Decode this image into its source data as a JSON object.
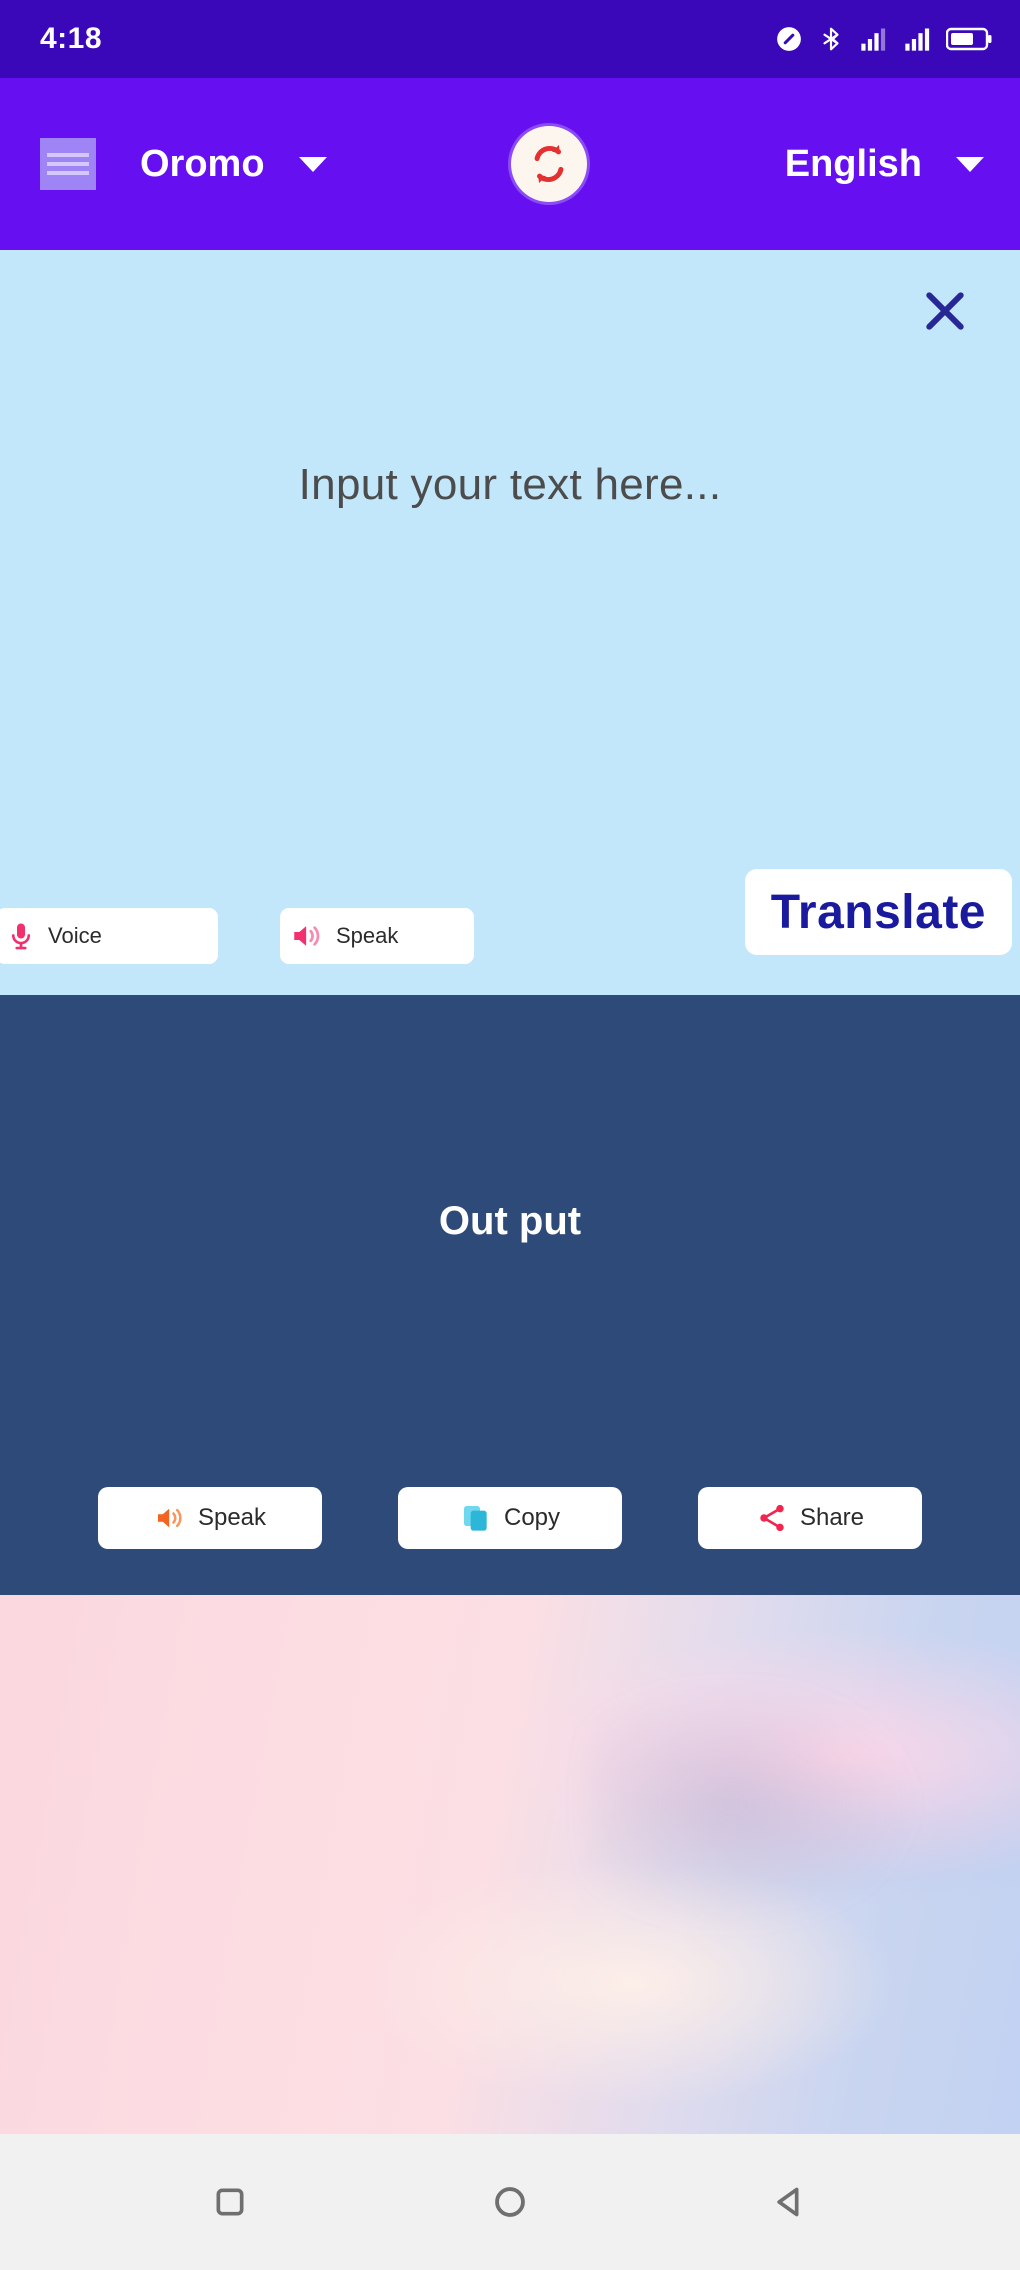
{
  "status_bar": {
    "time": "4:18",
    "icons": [
      {
        "name": "do-not-disturb-icon",
        "label": "do-not-disturb"
      },
      {
        "name": "bluetooth-icon",
        "label": "bluetooth"
      },
      {
        "name": "signal-bars-1-icon",
        "label": "signal-sim1"
      },
      {
        "name": "signal-bars-2-icon",
        "label": "signal-sim2"
      },
      {
        "name": "battery-icon",
        "label": "battery"
      }
    ]
  },
  "app_bar": {
    "menu_icon": "hamburger-menu-icon",
    "source_language": "Oromo",
    "target_language": "English",
    "swap_icon": "swap-languages-icon",
    "dropdown_icon": "chevron-down-icon",
    "background_color": "#6610f2"
  },
  "input_panel": {
    "background_color": "#c2e6fa",
    "close_icon": "close-x-icon",
    "placeholder": "Input your text here...",
    "value": "",
    "buttons": [
      {
        "label": "Voice",
        "icon": "microphone-icon",
        "icon_color": "#f3306e"
      },
      {
        "label": "Speak",
        "icon": "speaker-volume-icon",
        "icon_color": "#f3306e"
      }
    ],
    "translate_label": "Translate",
    "translate_text_color": "#1a1a9e"
  },
  "output_panel": {
    "background_color": "#2e4a78",
    "text": "Out put",
    "buttons": [
      {
        "label": "Speak",
        "icon": "speaker-volume-icon",
        "icon_color": "#f4631f"
      },
      {
        "label": "Copy",
        "icon": "copy-pages-icon",
        "icon_color": "#45c6e0"
      },
      {
        "label": "Share",
        "icon": "share-nodes-icon",
        "icon_color": "#f0264f"
      }
    ]
  },
  "hero": {
    "description": "pastel pink to blue blurred sky background"
  },
  "nav_bar": {
    "background_color": "#f1f1f1",
    "buttons": [
      {
        "name": "recents-button",
        "icon": "square-icon"
      },
      {
        "name": "home-button",
        "icon": "circle-icon"
      },
      {
        "name": "back-button",
        "icon": "triangle-left-icon"
      }
    ]
  }
}
